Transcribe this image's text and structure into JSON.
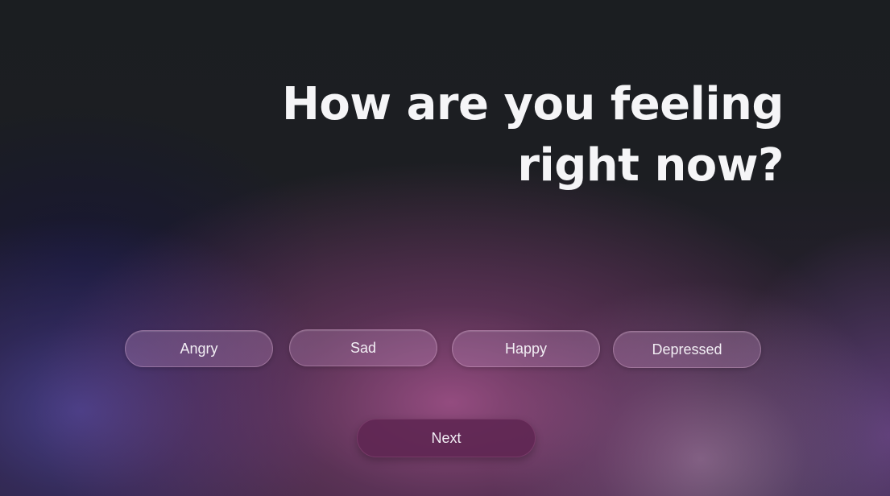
{
  "question": {
    "line1": "How are you feeling",
    "line2": "right now?"
  },
  "options": [
    {
      "label": "Angry"
    },
    {
      "label": "Sad"
    },
    {
      "label": "Happy"
    },
    {
      "label": "Depressed"
    }
  ],
  "actions": {
    "next_label": "Next"
  },
  "colors": {
    "background": "#1b1e21",
    "accent_glow": "#b25896",
    "pill_fill": "#7a4a78",
    "next_fill": "#5f2652",
    "text": "#f5f5f7"
  }
}
